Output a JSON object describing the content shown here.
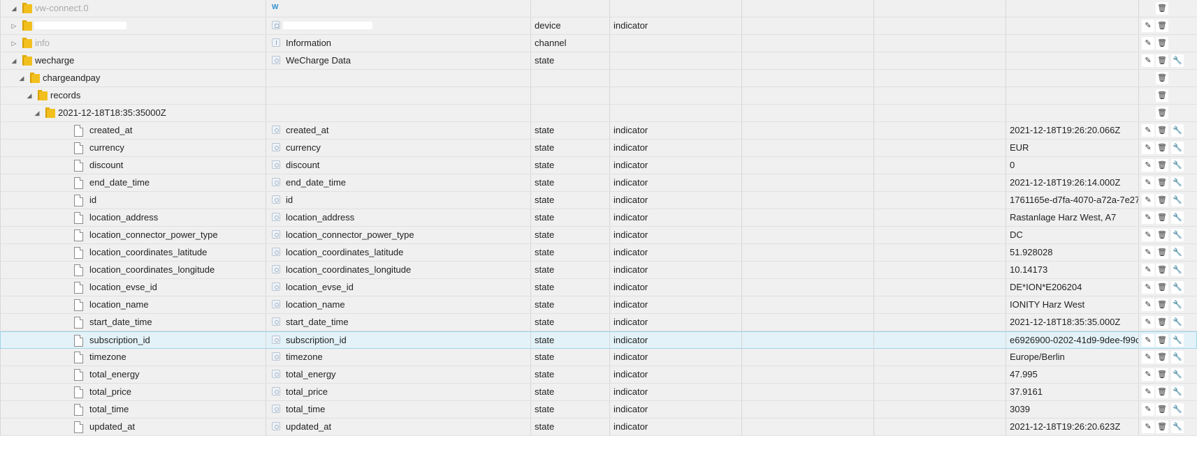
{
  "rows": [
    {
      "name": "vw-connect.0",
      "muted": true,
      "toggle": "◢",
      "level": 0,
      "type": "folder",
      "redact": false,
      "c2_icon": "w-logo",
      "c2_text": "",
      "c3": "",
      "c4": "",
      "c7": "",
      "buttons": [
        "delete"
      ]
    },
    {
      "name": "",
      "muted": false,
      "toggle": "▷",
      "level": 0,
      "type": "folder",
      "redact": true,
      "c2_icon": "device",
      "c2_text": "",
      "c2_redact": true,
      "c3": "device",
      "c4": "indicator",
      "c7": "",
      "buttons": [
        "edit",
        "delete"
      ]
    },
    {
      "name": "info",
      "muted": true,
      "toggle": "▷",
      "level": 0,
      "type": "folder",
      "redact": false,
      "c2_icon": "info",
      "c2_text": "Information",
      "c3": "channel",
      "c4": "",
      "c7": "",
      "buttons": [
        "edit",
        "delete"
      ]
    },
    {
      "name": "wecharge",
      "muted": false,
      "toggle": "◢",
      "level": 0,
      "type": "folder",
      "redact": false,
      "c2_icon": "state",
      "c2_text": "WeCharge Data",
      "c3": "state",
      "c4": "",
      "c7": "",
      "buttons": [
        "edit",
        "delete",
        "wrench"
      ]
    },
    {
      "name": "chargeandpay",
      "muted": false,
      "toggle": "◢",
      "level": 1,
      "type": "folder",
      "redact": false,
      "c2_icon": "",
      "c2_text": "",
      "c3": "",
      "c4": "",
      "c7": "",
      "buttons": [
        "delete"
      ]
    },
    {
      "name": "records",
      "muted": false,
      "toggle": "◢",
      "level": 2,
      "type": "folder",
      "redact": false,
      "c2_icon": "",
      "c2_text": "",
      "c3": "",
      "c4": "",
      "c7": "",
      "buttons": [
        "delete"
      ]
    },
    {
      "name": "2021-12-18T18:35:35000Z",
      "muted": false,
      "toggle": "◢",
      "level": 3,
      "type": "folder",
      "redact": false,
      "c2_icon": "",
      "c2_text": "",
      "c3": "",
      "c4": "",
      "c7": "",
      "buttons": [
        "delete"
      ]
    },
    {
      "name": "created_at",
      "level": 4,
      "type": "file",
      "c2_icon": "state",
      "c2_text": "created_at",
      "c3": "state",
      "c4": "indicator",
      "c7": "2021-12-18T19:26:20.066Z",
      "buttons": [
        "edit",
        "delete",
        "wrench"
      ]
    },
    {
      "name": "currency",
      "level": 4,
      "type": "file",
      "c2_icon": "state",
      "c2_text": "currency",
      "c3": "state",
      "c4": "indicator",
      "c7": "EUR",
      "buttons": [
        "edit",
        "delete",
        "wrench"
      ]
    },
    {
      "name": "discount",
      "level": 4,
      "type": "file",
      "c2_icon": "state",
      "c2_text": "discount",
      "c3": "state",
      "c4": "indicator",
      "c7": "0",
      "buttons": [
        "edit",
        "delete",
        "wrench"
      ]
    },
    {
      "name": "end_date_time",
      "level": 4,
      "type": "file",
      "c2_icon": "state",
      "c2_text": "end_date_time",
      "c3": "state",
      "c4": "indicator",
      "c7": "2021-12-18T19:26:14.000Z",
      "buttons": [
        "edit",
        "delete",
        "wrench"
      ]
    },
    {
      "name": "id",
      "level": 4,
      "type": "file",
      "c2_icon": "state",
      "c2_text": "id",
      "c3": "state",
      "c4": "indicator",
      "c7": "1761165e-d7fa-4070-a72a-7e27",
      "buttons": [
        "edit",
        "delete",
        "wrench"
      ]
    },
    {
      "name": "location_address",
      "level": 4,
      "type": "file",
      "c2_icon": "state",
      "c2_text": "location_address",
      "c3": "state",
      "c4": "indicator",
      "c7": "Rastanlage Harz West, A7",
      "buttons": [
        "edit",
        "delete",
        "wrench"
      ]
    },
    {
      "name": "location_connector_power_type",
      "level": 4,
      "type": "file",
      "c2_icon": "state",
      "c2_text": "location_connector_power_type",
      "c3": "state",
      "c4": "indicator",
      "c7": "DC",
      "buttons": [
        "edit",
        "delete",
        "wrench"
      ]
    },
    {
      "name": "location_coordinates_latitude",
      "level": 4,
      "type": "file",
      "c2_icon": "state",
      "c2_text": "location_coordinates_latitude",
      "c3": "state",
      "c4": "indicator",
      "c7": "51.928028",
      "buttons": [
        "edit",
        "delete",
        "wrench"
      ]
    },
    {
      "name": "location_coordinates_longitude",
      "level": 4,
      "type": "file",
      "c2_icon": "state",
      "c2_text": "location_coordinates_longitude",
      "c3": "state",
      "c4": "indicator",
      "c7": "10.14173",
      "buttons": [
        "edit",
        "delete",
        "wrench"
      ]
    },
    {
      "name": "location_evse_id",
      "level": 4,
      "type": "file",
      "c2_icon": "state",
      "c2_text": "location_evse_id",
      "c3": "state",
      "c4": "indicator",
      "c7": "DE*ION*E206204",
      "buttons": [
        "edit",
        "delete",
        "wrench"
      ]
    },
    {
      "name": "location_name",
      "level": 4,
      "type": "file",
      "c2_icon": "state",
      "c2_text": "location_name",
      "c3": "state",
      "c4": "indicator",
      "c7": "IONITY Harz West",
      "buttons": [
        "edit",
        "delete",
        "wrench"
      ]
    },
    {
      "name": "start_date_time",
      "level": 4,
      "type": "file",
      "c2_icon": "state",
      "c2_text": "start_date_time",
      "c3": "state",
      "c4": "indicator",
      "c7": "2021-12-18T18:35:35.000Z",
      "buttons": [
        "edit",
        "delete",
        "wrench"
      ]
    },
    {
      "name": "subscription_id",
      "level": 4,
      "type": "file",
      "selected": true,
      "c2_icon": "state",
      "c2_text": "subscription_id",
      "c3": "state",
      "c4": "indicator",
      "c7": "e6926900-0202-41d9-9dee-f99c",
      "buttons": [
        "edit",
        "delete",
        "wrench"
      ]
    },
    {
      "name": "timezone",
      "level": 4,
      "type": "file",
      "c2_icon": "state",
      "c2_text": "timezone",
      "c3": "state",
      "c4": "indicator",
      "c7": "Europe/Berlin",
      "buttons": [
        "edit",
        "delete",
        "wrench"
      ]
    },
    {
      "name": "total_energy",
      "level": 4,
      "type": "file",
      "c2_icon": "state",
      "c2_text": "total_energy",
      "c3": "state",
      "c4": "indicator",
      "c7": "47.995",
      "buttons": [
        "edit",
        "delete",
        "wrench"
      ]
    },
    {
      "name": "total_price",
      "level": 4,
      "type": "file",
      "c2_icon": "state",
      "c2_text": "total_price",
      "c3": "state",
      "c4": "indicator",
      "c7": "37.9161",
      "buttons": [
        "edit",
        "delete",
        "wrench"
      ]
    },
    {
      "name": "total_time",
      "level": 4,
      "type": "file",
      "c2_icon": "state",
      "c2_text": "total_time",
      "c3": "state",
      "c4": "indicator",
      "c7": "3039",
      "buttons": [
        "edit",
        "delete",
        "wrench"
      ]
    },
    {
      "name": "updated_at",
      "level": 4,
      "type": "file",
      "c2_icon": "state",
      "c2_text": "updated_at",
      "c3": "state",
      "c4": "indicator",
      "c7": "2021-12-18T19:26:20.623Z",
      "buttons": [
        "edit",
        "delete",
        "wrench"
      ]
    }
  ],
  "button_glyphs": {
    "edit": "✎",
    "delete": "🗑",
    "wrench": "🔧"
  },
  "colors": {
    "folder": "#f2c01e",
    "selected_row": "#e3f2f8",
    "row_bg": "#f0f0f0"
  }
}
